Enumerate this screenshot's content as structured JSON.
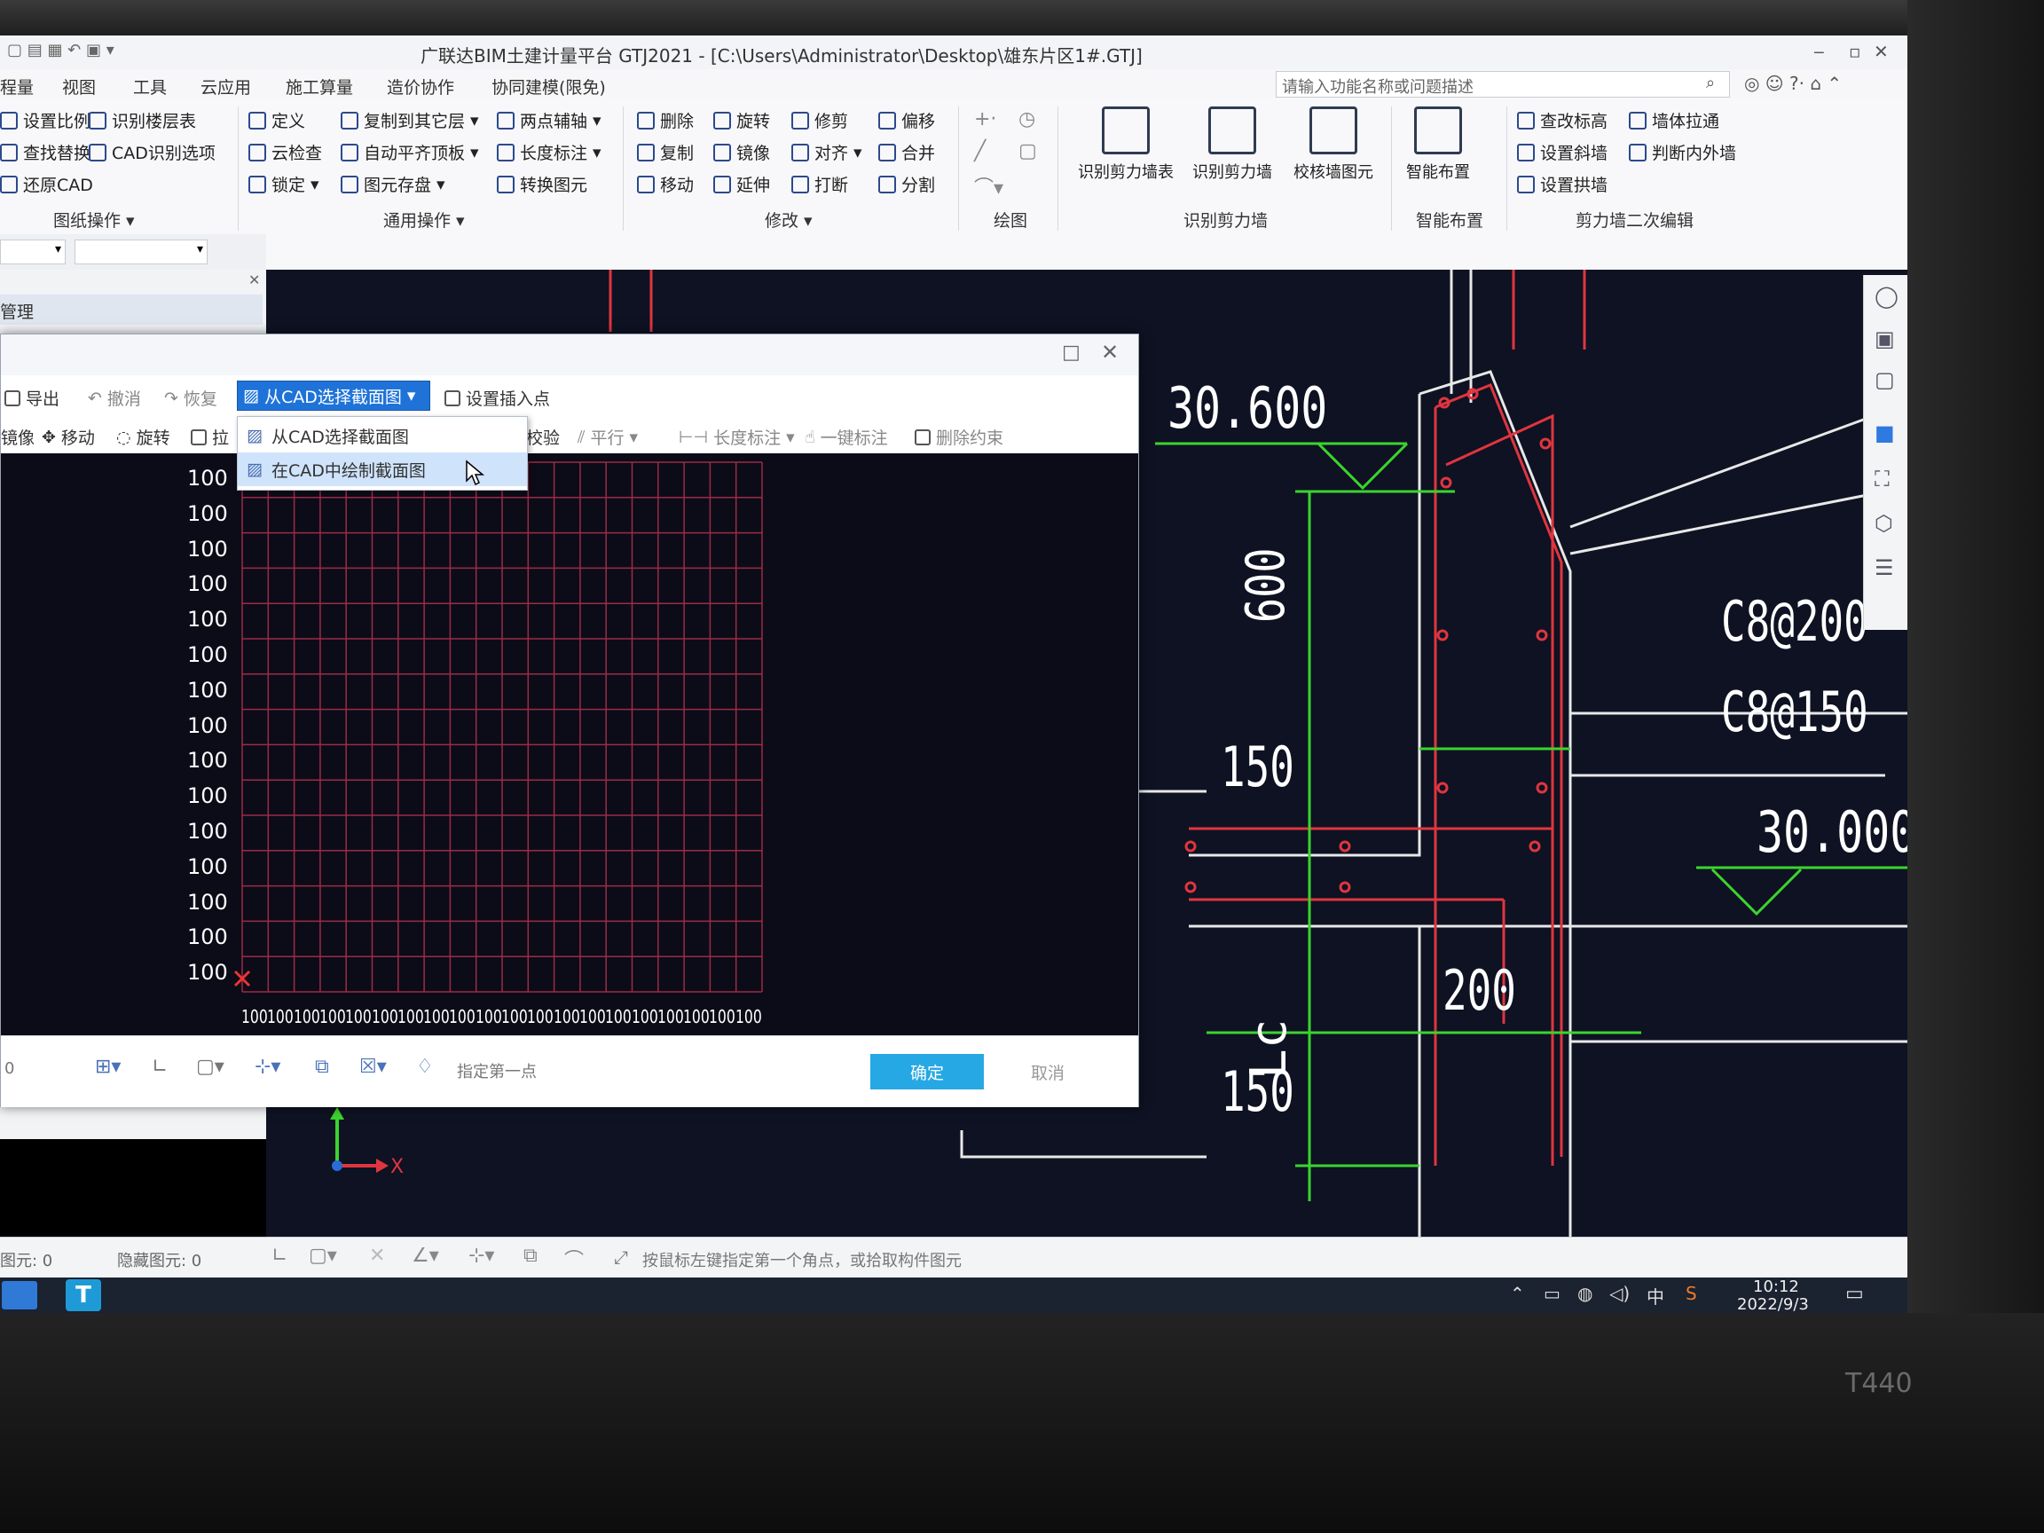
{
  "window": {
    "title": "广联达BIM土建计量平台 GTJ2021 - [C:\\Users\\Administrator\\Desktop\\雄东片区1#.GTJ]"
  },
  "tabs": [
    "程量",
    "视图",
    "工具",
    "云应用",
    "施工算量",
    "造价协作",
    "协同建模(限免)"
  ],
  "search": {
    "placeholder": "请输入功能名称或问题描述"
  },
  "ribbon": {
    "drawing_ops": {
      "items": [
        "设置比例",
        "识别楼层表",
        "查找替换",
        "CAD识别选项",
        "还原CAD"
      ],
      "group": "图纸操作"
    },
    "general_ops": {
      "items": [
        "定义",
        "复制到其它层",
        "两点辅轴",
        "云检查",
        "自动平齐顶板",
        "长度标注",
        "锁定",
        "图元存盘",
        "转换图元"
      ],
      "group": "通用操作"
    },
    "modify": {
      "items": [
        "删除",
        "旋转",
        "修剪",
        "偏移",
        "复制",
        "镜像",
        "对齐",
        "合并",
        "移动",
        "延伸",
        "打断",
        "分割"
      ],
      "group": "修改"
    },
    "draw": {
      "group": "绘图"
    },
    "recognize": {
      "items": [
        "识别剪力墙表",
        "识别剪力墙",
        "校核墙图元"
      ],
      "group": "识别剪力墙"
    },
    "smart": {
      "items": [
        "智能布置"
      ],
      "group": "智能布置"
    },
    "secondary": {
      "items": [
        "查改标高",
        "墙体拉通",
        "设置斜墙",
        "判断内外墙",
        "设置拱墙"
      ],
      "group": "剪力墙二次编辑"
    }
  },
  "left_panel": {
    "tab": "管理"
  },
  "dialog": {
    "toolbar1": {
      "export": "导出",
      "undo": "撤消",
      "redo": "恢复",
      "from_cad": "从CAD选择截面图",
      "set_insert": "设置插入点"
    },
    "toolbar2": {
      "mirror": "镜像",
      "move": "移动",
      "rotate": "旋转",
      "stretch": "拉",
      "check": "校验",
      "parallel": "平行",
      "length_dim": "长度标注",
      "one_click": "一键标注",
      "delete_constraint": "删除约束"
    },
    "dropdown": {
      "items": [
        "从CAD选择截面图",
        "在CAD中绘制截面图"
      ],
      "selected": 1
    },
    "y_labels": [
      "100",
      "100",
      "100",
      "100",
      "100",
      "100",
      "100",
      "100",
      "100",
      "100",
      "100",
      "100",
      "100",
      "100",
      "100"
    ],
    "x_labels": [
      "100",
      "100",
      "100",
      "100",
      "100",
      "100",
      "100",
      "100",
      "100",
      "100",
      "100",
      "100",
      "100",
      "100",
      "100",
      "100",
      "100",
      "100",
      "100",
      "100"
    ],
    "footer": {
      "zero": "0",
      "hint": "指定第一点",
      "ok": "确定",
      "cancel": "取消"
    }
  },
  "cad_labels": {
    "elev1": "30.600",
    "elev2": "30.000",
    "rebar1": "C8@200",
    "rebar2": "C8@150",
    "dim600": "600",
    "dim150a": "150",
    "dim150b": "150",
    "dim200": "200",
    "dimLc": "Lc"
  },
  "status": {
    "elements": "图元: 0",
    "hidden": "隐藏图元: 0",
    "hint": "按鼠标左键指定第一个角点，或拾取构件图元"
  },
  "taskbar": {
    "ime": "中",
    "time": "10:12",
    "date": "2022/9/3"
  },
  "device": {
    "model": "T440"
  },
  "colors": {
    "accent": "#1f73d8",
    "ok_button": "#26a8e4",
    "cad_bg": "#0e1222",
    "grid": "#c0395a"
  }
}
